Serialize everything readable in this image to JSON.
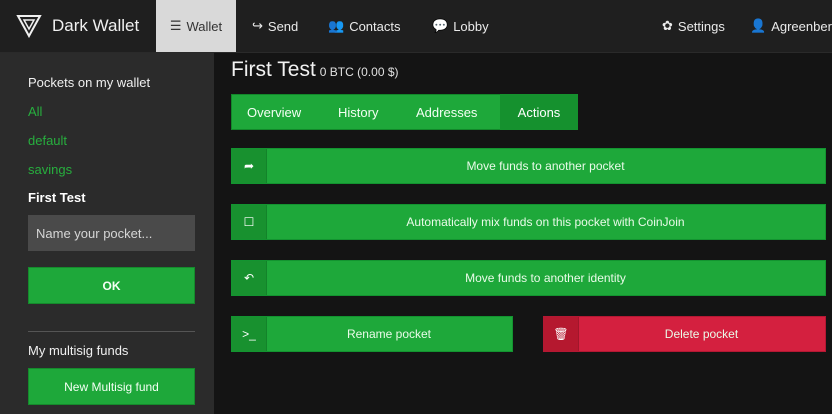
{
  "brand": {
    "name": "Dark Wallet",
    "icon": "dark-wallet-triangle-logo"
  },
  "nav": {
    "wallet": {
      "label": "Wallet",
      "glyph": "☰",
      "icon": "list-icon"
    },
    "send": {
      "label": "Send",
      "glyph": "↪",
      "icon": "share-arrow-icon"
    },
    "contacts": {
      "label": "Contacts",
      "glyph": "👥",
      "icon": "users-icon"
    },
    "lobby": {
      "label": "Lobby",
      "glyph": "💬",
      "icon": "chat-icon"
    },
    "settings": {
      "label": "Settings",
      "glyph": "✿",
      "icon": "gear-icon"
    },
    "user": {
      "label": "Agreenberg",
      "glyph": "👤",
      "icon": "user-icon"
    }
  },
  "sidebar": {
    "heading": "Pockets on my wallet",
    "pockets": [
      "All",
      "default",
      "savings"
    ],
    "active_pocket": "First Test",
    "name_placeholder": "Name your pocket...",
    "ok_label": "OK",
    "multisig_heading": "My multisig funds",
    "new_multisig_label": "New Multisig fund"
  },
  "main": {
    "title": "First Test",
    "balance": "0 BTC (0.00 $)",
    "tabs": [
      "Overview",
      "History",
      "Addresses",
      "Actions"
    ],
    "active_tab": "Actions",
    "actions": {
      "move_pocket": {
        "label": "Move funds to another pocket",
        "glyph": "➦",
        "icon": "share-arrow-icon"
      },
      "coinjoin": {
        "label": "Automatically mix funds on this pocket with CoinJoin",
        "glyph": "☐",
        "icon": "checkbox-icon"
      },
      "move_identity": {
        "label": "Move funds to another identity",
        "glyph": "↶",
        "icon": "reply-icon"
      },
      "rename": {
        "label": "Rename pocket",
        "glyph": ">_",
        "icon": "terminal-icon"
      },
      "delete": {
        "label": "Delete pocket",
        "glyph": "🗑",
        "icon": "trash-icon"
      }
    },
    "colors": {
      "accent_green": "#1ea83a",
      "danger_red": "#d4203f",
      "link_green": "#27ae3e"
    }
  }
}
